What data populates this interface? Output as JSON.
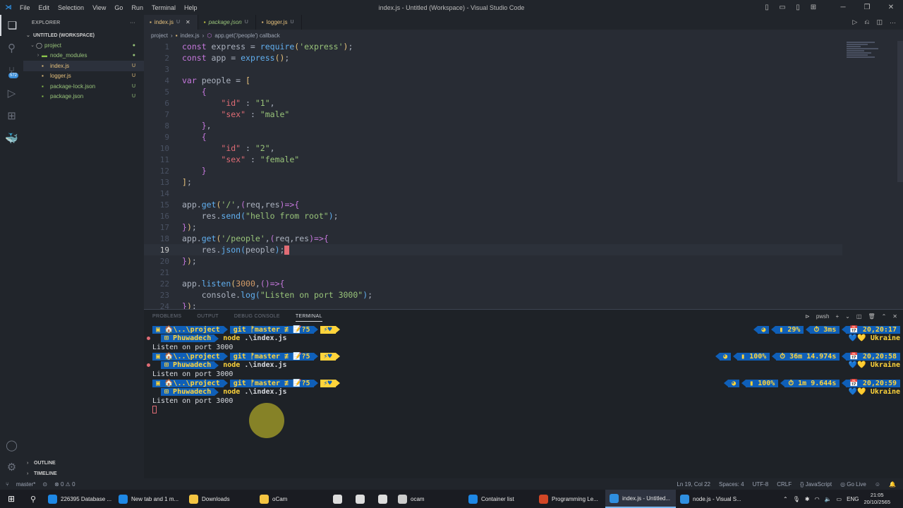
{
  "titlebar": {
    "menu": [
      "File",
      "Edit",
      "Selection",
      "View",
      "Go",
      "Run",
      "Terminal",
      "Help"
    ],
    "title": "index.js - Untitled (Workspace) - Visual Studio Code"
  },
  "activity": {
    "scm_badge": "572"
  },
  "sidebar": {
    "header": "EXPLORER",
    "workspace": "UNTITLED (WORKSPACE)",
    "items": [
      {
        "label": "project",
        "status": "●"
      },
      {
        "label": "node_modules",
        "status": "●"
      },
      {
        "label": "index.js",
        "status": "U"
      },
      {
        "label": "logger.js",
        "status": "U"
      },
      {
        "label": "package-lock.json",
        "status": "U"
      },
      {
        "label": "package.json",
        "status": "U"
      }
    ],
    "outline": "OUTLINE",
    "timeline": "TIMELINE"
  },
  "tabs": [
    {
      "label": "index.js",
      "status": "U",
      "close": "✕"
    },
    {
      "label": "package.json",
      "status": "U"
    },
    {
      "label": "logger.js",
      "status": "U"
    }
  ],
  "breadcrumb": [
    "project",
    "index.js",
    "app.get('/people') callback"
  ],
  "code_lines": [
    {
      "n": "1",
      "html": "<span class='kw'>const</span> express = <span class='fn'>require</span><span class='br1'>(</span><span class='str'>'express'</span><span class='br1'>)</span>;"
    },
    {
      "n": "2",
      "html": "<span class='kw'>const</span> app = <span class='fn'>express</span><span class='br1'>()</span>;"
    },
    {
      "n": "3",
      "html": ""
    },
    {
      "n": "4",
      "html": "<span class='kw'>var</span> people = <span class='br1'>[</span>"
    },
    {
      "n": "5",
      "html": "    <span class='br2'>{</span>"
    },
    {
      "n": "6",
      "html": "        <span class='var'>\"id\"</span> : <span class='str'>\"1\"</span>,"
    },
    {
      "n": "7",
      "html": "        <span class='var'>\"sex\"</span> : <span class='str'>\"male\"</span>"
    },
    {
      "n": "8",
      "html": "    <span class='br2'>}</span>,"
    },
    {
      "n": "9",
      "html": "    <span class='br2'>{</span>"
    },
    {
      "n": "10",
      "html": "        <span class='var'>\"id\"</span> : <span class='str'>\"2\"</span>,"
    },
    {
      "n": "11",
      "html": "        <span class='var'>\"sex\"</span> : <span class='str'>\"female\"</span>"
    },
    {
      "n": "12",
      "html": "    <span class='br2'>}</span>"
    },
    {
      "n": "13",
      "html": "<span class='br1'>]</span>;"
    },
    {
      "n": "14",
      "html": ""
    },
    {
      "n": "15",
      "html": "app.<span class='fn'>get</span><span class='br1'>(</span><span class='str'>'/'</span>,<span class='br2'>(</span>req,res<span class='br2'>)</span><span class='kw'>=></span><span class='br2'>{</span>"
    },
    {
      "n": "16",
      "html": "    res.<span class='fn'>send</span><span class='br3'>(</span><span class='str'>\"hello from root\"</span><span class='br3'>)</span>;"
    },
    {
      "n": "17",
      "html": "<span class='br2'>}</span><span class='br1'>)</span>;"
    },
    {
      "n": "18",
      "html": "app.<span class='fn'>get</span><span class='br1'>(</span><span class='str'>'/people'</span>,<span class='br2'>(</span>req,res<span class='br2'>)</span><span class='kw'>=></span><span class='br2'>{</span>"
    },
    {
      "n": "19",
      "html": "    res.<span class='fn'>json</span><span class='br3'>(</span>people<span class='br3'>)</span>;<span class='cursor'></span>"
    },
    {
      "n": "20",
      "html": "<span class='br2'>}</span><span class='br1'>)</span>;"
    },
    {
      "n": "21",
      "html": ""
    },
    {
      "n": "22",
      "html": "app.<span class='fn'>listen</span><span class='br1'>(</span><span class='num'>3000</span>,<span class='br2'>()</span><span class='kw'>=></span><span class='br2'>{</span>"
    },
    {
      "n": "23",
      "html": "    console.<span class='fn'>log</span><span class='br3'>(</span><span class='str'>\"Listen on port 3000\"</span><span class='br3'>)</span>;"
    },
    {
      "n": "24",
      "html": "<span class='br2'>}</span><span class='br1'>)</span>;"
    }
  ],
  "panel": {
    "tabs": [
      "PROBLEMS",
      "OUTPUT",
      "DEBUG CONSOLE",
      "TERMINAL"
    ],
    "shell": "pwsh"
  },
  "terminal": {
    "path": "🏠\\..\\project",
    "git": "git ᚠmaster ≢ 📝?5",
    "heart": "⚡♥",
    "user": "Phuwadech",
    "cmd": "node",
    "arg": ".\\index.js",
    "output": "Listen on port 3000",
    "ukraine": "💙💛 Ukraine",
    "blocks": [
      {
        "batt": "29%",
        "dur": "3ms",
        "time": "20,20:17"
      },
      {
        "batt": "100%",
        "dur": "36m 14.974s",
        "time": "20,20:58"
      },
      {
        "batt": "100%",
        "dur": "1m 9.644s",
        "time": "20,20:59"
      }
    ]
  },
  "statusbar": {
    "branch": "master*",
    "errors": "⊗ 0 ⚠ 0",
    "position": "Ln 19, Col 22",
    "spaces": "Spaces: 4",
    "encoding": "UTF-8",
    "eol": "CRLF",
    "language": "JavaScript",
    "golive": "Go Live"
  },
  "taskbar": {
    "items": [
      {
        "label": "226395 Database ...",
        "color": "#1e88e5"
      },
      {
        "label": "New tab and 1 m...",
        "color": "#1e88e5"
      },
      {
        "label": "Downloads",
        "color": "#f4c542"
      },
      {
        "label": "oCam",
        "color": "#f4c542"
      },
      {
        "label": "ocam",
        "color": "#cccccc"
      },
      {
        "label": "Container list",
        "color": "#1e88e5"
      },
      {
        "label": "Programming Le...",
        "color": "#d24726"
      },
      {
        "label": "index.js - Untitled...",
        "color": "#2f8fe0"
      },
      {
        "label": "node.js - Visual S...",
        "color": "#2f8fe0"
      }
    ],
    "lang": "ENG",
    "time": "21:05",
    "date": "20/10/2565"
  }
}
